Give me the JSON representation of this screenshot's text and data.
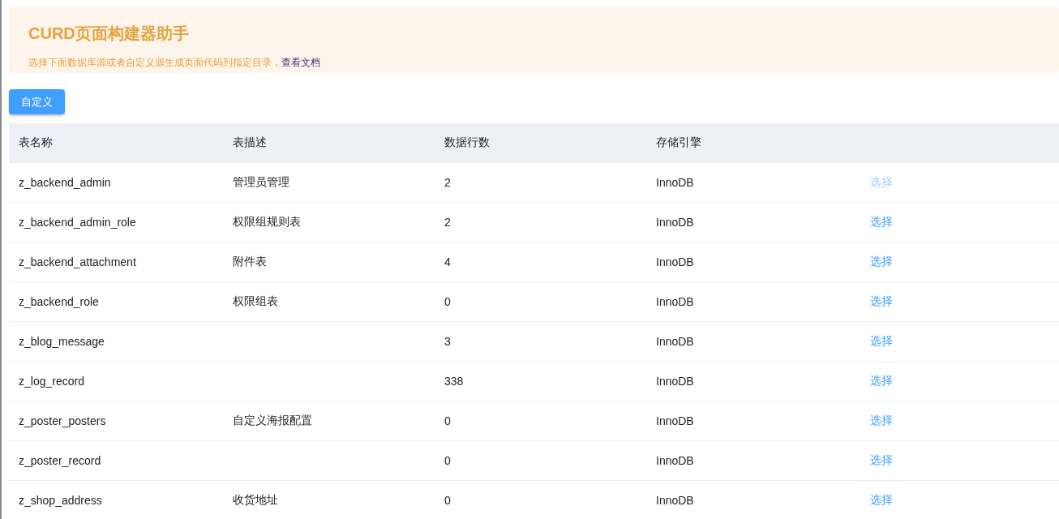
{
  "banner": {
    "title": "CURD页面构建器助手",
    "description": "选择下面数据库源或者自定义源生成页面代码到指定目录，",
    "doc_link": "查看文档"
  },
  "custom_button": "自定义",
  "table": {
    "columns": [
      "表名称",
      "表描述",
      "数据行数",
      "存储引擎"
    ],
    "rows": [
      {
        "name": "z_backend_admin",
        "description": "管理员管理",
        "rows": "2",
        "engine": "InnoDB",
        "action": "选择",
        "disabled": true
      },
      {
        "name": "z_backend_admin_role",
        "description": "权限组规则表",
        "rows": "2",
        "engine": "InnoDB",
        "action": "选择",
        "disabled": false
      },
      {
        "name": "z_backend_attachment",
        "description": "附件表",
        "rows": "4",
        "engine": "InnoDB",
        "action": "选择",
        "disabled": false
      },
      {
        "name": "z_backend_role",
        "description": "权限组表",
        "rows": "0",
        "engine": "InnoDB",
        "action": "选择",
        "disabled": false
      },
      {
        "name": "z_blog_message",
        "rows": "3",
        "engine": "InnoDB",
        "action": "选择",
        "disabled": false
      },
      {
        "name": "z_log_record",
        "rows": "338",
        "engine": "InnoDB",
        "action": "选择",
        "disabled": false
      },
      {
        "name": "z_poster_posters",
        "description": "自定义海报配置",
        "rows": "0",
        "engine": "InnoDB",
        "action": "选择",
        "disabled": false
      },
      {
        "name": "z_poster_record",
        "rows": "0",
        "engine": "InnoDB",
        "action": "选择",
        "disabled": false
      },
      {
        "name": "z_shop_address",
        "description": "收货地址",
        "rows": "0",
        "engine": "InnoDB",
        "action": "选择",
        "disabled": false
      }
    ]
  }
}
